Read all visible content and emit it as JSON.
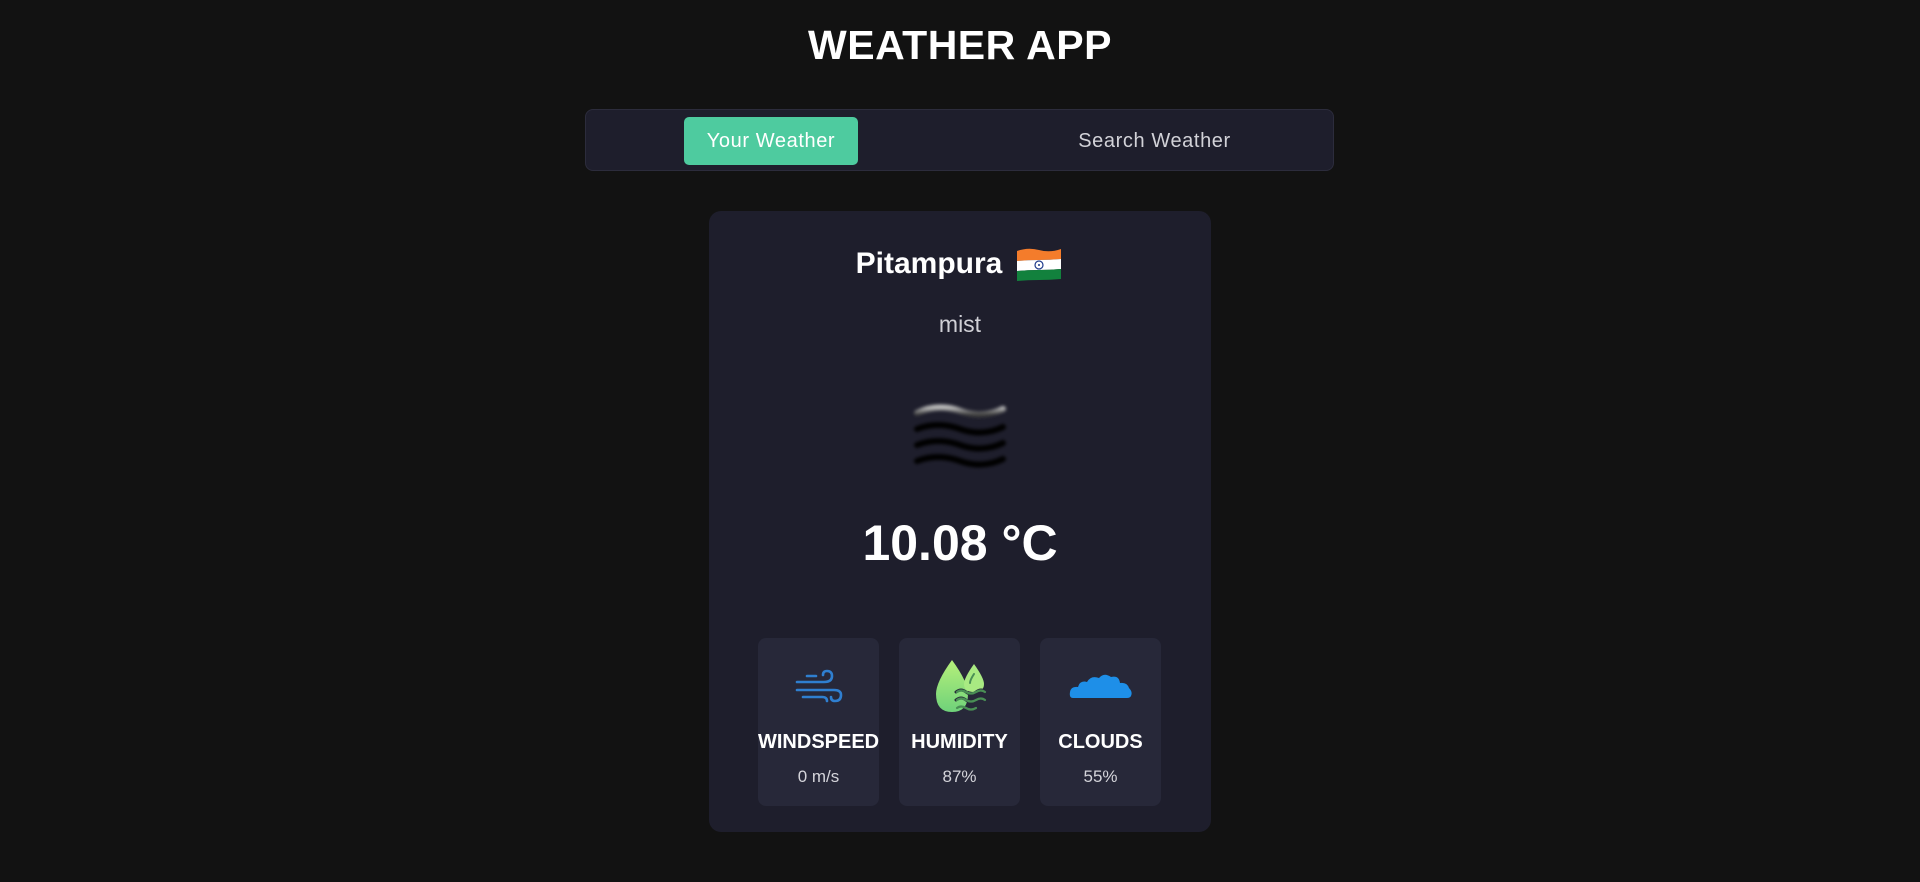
{
  "app": {
    "title": "WEATHER APP"
  },
  "tabs": [
    {
      "label": "Your Weather",
      "active": true
    },
    {
      "label": "Search Weather",
      "active": false
    }
  ],
  "weather": {
    "city": "Pitampura",
    "country_flag_icon": "india-flag-icon",
    "condition": "mist",
    "condition_icon": "mist-icon",
    "temperature": "10.08 °C"
  },
  "stats": [
    {
      "label": "WINDSPEED",
      "value": "0 m/s",
      "icon": "wind-icon"
    },
    {
      "label": "HUMIDITY",
      "value": "87%",
      "icon": "humidity-icon"
    },
    {
      "label": "CLOUDS",
      "value": "55%",
      "icon": "cloud-icon"
    }
  ],
  "colors": {
    "background": "#121212",
    "panel": "#1e1e2c",
    "stat_card": "#272839",
    "accent": "#4ecb9f"
  }
}
